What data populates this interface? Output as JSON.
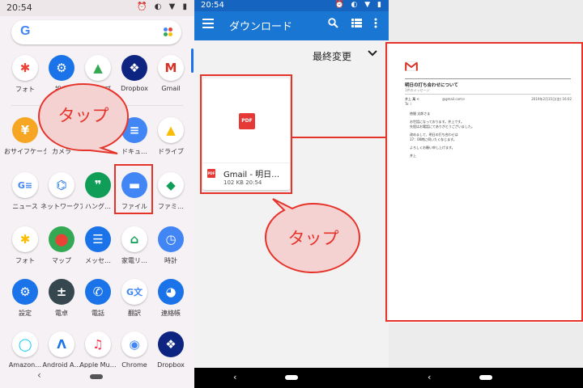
{
  "launcher": {
    "status_time": "20:54",
    "search_logo": "G",
    "apps": [
      {
        "label": "フォト",
        "icon": "photos-icon",
        "color": "#ffffff",
        "glyph": "✱",
        "fg": "#ea4335"
      },
      {
        "label": "設定",
        "icon": "settings-icon",
        "color": "#1a73e8",
        "glyph": "⚙",
        "fg": "#ffffff"
      },
      {
        "label": "ドライブ",
        "icon": "drive-icon",
        "color": "#ffffff",
        "glyph": "▲",
        "fg": "#34a853"
      },
      {
        "label": "Dropbox",
        "icon": "dropbox-icon",
        "color": "#0d2481",
        "glyph": "❖",
        "fg": "#ffffff"
      },
      {
        "label": "Gmail",
        "icon": "gmail-icon",
        "color": "#ffffff",
        "glyph": "M",
        "fg": "#d93025"
      },
      {
        "label": "おサイフケータイ",
        "icon": "osaifu-icon",
        "color": "#f6a623",
        "glyph": "¥",
        "fg": "#ffffff"
      },
      {
        "label": "カメラ",
        "icon": "camera-icon",
        "color": "#4285f4",
        "glyph": "◉",
        "fg": "#ffffff"
      },
      {
        "label": "",
        "icon": "blank-icon",
        "color": "#ffffff",
        "glyph": "",
        "fg": "#ffffff"
      },
      {
        "label": "ドキュ…",
        "icon": "docs-icon",
        "color": "#4285f4",
        "glyph": "≡",
        "fg": "#ffffff"
      },
      {
        "label": "ドライブ",
        "icon": "drive-icon",
        "color": "#ffffff",
        "glyph": "▲",
        "fg": "#fbbc04"
      },
      {
        "label": "ニュース",
        "icon": "news-icon",
        "color": "#ffffff",
        "glyph": "G≡",
        "fg": "#4285f4"
      },
      {
        "label": "ネットワークア…",
        "icon": "network-icon",
        "color": "#ffffff",
        "glyph": "⌬",
        "fg": "#1a73e8"
      },
      {
        "label": "ハング…",
        "icon": "hangouts-icon",
        "color": "#0f9d58",
        "glyph": "❞",
        "fg": "#ffffff"
      },
      {
        "label": "ファイル",
        "icon": "files-icon",
        "color": "#4285f4",
        "glyph": "▬",
        "fg": "#ffffff"
      },
      {
        "label": "ファミ…",
        "icon": "family-icon",
        "color": "#ffffff",
        "glyph": "◆",
        "fg": "#0f9d58"
      },
      {
        "label": "フォト",
        "icon": "photos-icon",
        "color": "#ffffff",
        "glyph": "✱",
        "fg": "#fbbc04"
      },
      {
        "label": "マップ",
        "icon": "maps-icon",
        "color": "#34a853",
        "glyph": "⬤",
        "fg": "#ea4335"
      },
      {
        "label": "メッセ…",
        "icon": "messages-icon",
        "color": "#1a73e8",
        "glyph": "☰",
        "fg": "#ffffff"
      },
      {
        "label": "家電リ…",
        "icon": "remote-icon",
        "color": "#ffffff",
        "glyph": "⌂",
        "fg": "#0f9d58"
      },
      {
        "label": "時計",
        "icon": "clock-icon",
        "color": "#4285f4",
        "glyph": "◷",
        "fg": "#ffffff"
      },
      {
        "label": "設定",
        "icon": "settings-icon",
        "color": "#1a73e8",
        "glyph": "⚙",
        "fg": "#ffffff"
      },
      {
        "label": "電卓",
        "icon": "calculator-icon",
        "color": "#37474f",
        "glyph": "±",
        "fg": "#ffffff"
      },
      {
        "label": "電話",
        "icon": "phone-icon",
        "color": "#1a73e8",
        "glyph": "✆",
        "fg": "#ffffff"
      },
      {
        "label": "翻訳",
        "icon": "translate-icon",
        "color": "#ffffff",
        "glyph": "G文",
        "fg": "#4285f4"
      },
      {
        "label": "連絡帳",
        "icon": "contacts-icon",
        "color": "#1a73e8",
        "glyph": "◕",
        "fg": "#ffffff"
      },
      {
        "label": "Amazon…",
        "icon": "alexa-icon",
        "color": "#ffffff",
        "glyph": "◯",
        "fg": "#00caff"
      },
      {
        "label": "Android A…",
        "icon": "android-auto-icon",
        "color": "#ffffff",
        "glyph": "Λ",
        "fg": "#1a73e8"
      },
      {
        "label": "Apple Mu…",
        "icon": "apple-music-icon",
        "color": "#ffffff",
        "glyph": "♫",
        "fg": "#fa2d48"
      },
      {
        "label": "Chrome",
        "icon": "chrome-icon",
        "color": "#ffffff",
        "glyph": "◉",
        "fg": "#4285f4"
      },
      {
        "label": "Dropbox",
        "icon": "dropbox-icon",
        "color": "#0d2481",
        "glyph": "❖",
        "fg": "#ffffff"
      }
    ],
    "callout": "タップ"
  },
  "files_app": {
    "status_time": "20:54",
    "title": "ダウンロード",
    "sort_label": "最終変更",
    "file": {
      "badge": "PDF",
      "name": "Gmail - 明日…",
      "info": "102 KB 20:54"
    },
    "callout": "タップ"
  },
  "pdf_viewer": {
    "subject": "明日の打ち合わせについて",
    "message_count": "1件のメッセージ",
    "sender": "井上 萬 <",
    "sender_address": "@gmail.com>",
    "to": "To: i",
    "date": "2019年2月15日(金) 16:02",
    "body": [
      "徳間 太郎さま",
      "",
      "お世話になっております。井上です。",
      "先程はお電話にてありがとうございました。",
      "",
      "改めまして、明日の打ち合わせは",
      "17：00時に伺いたく存じます。",
      "",
      "よろしくお願い申し上げます。",
      "",
      "井上"
    ]
  }
}
